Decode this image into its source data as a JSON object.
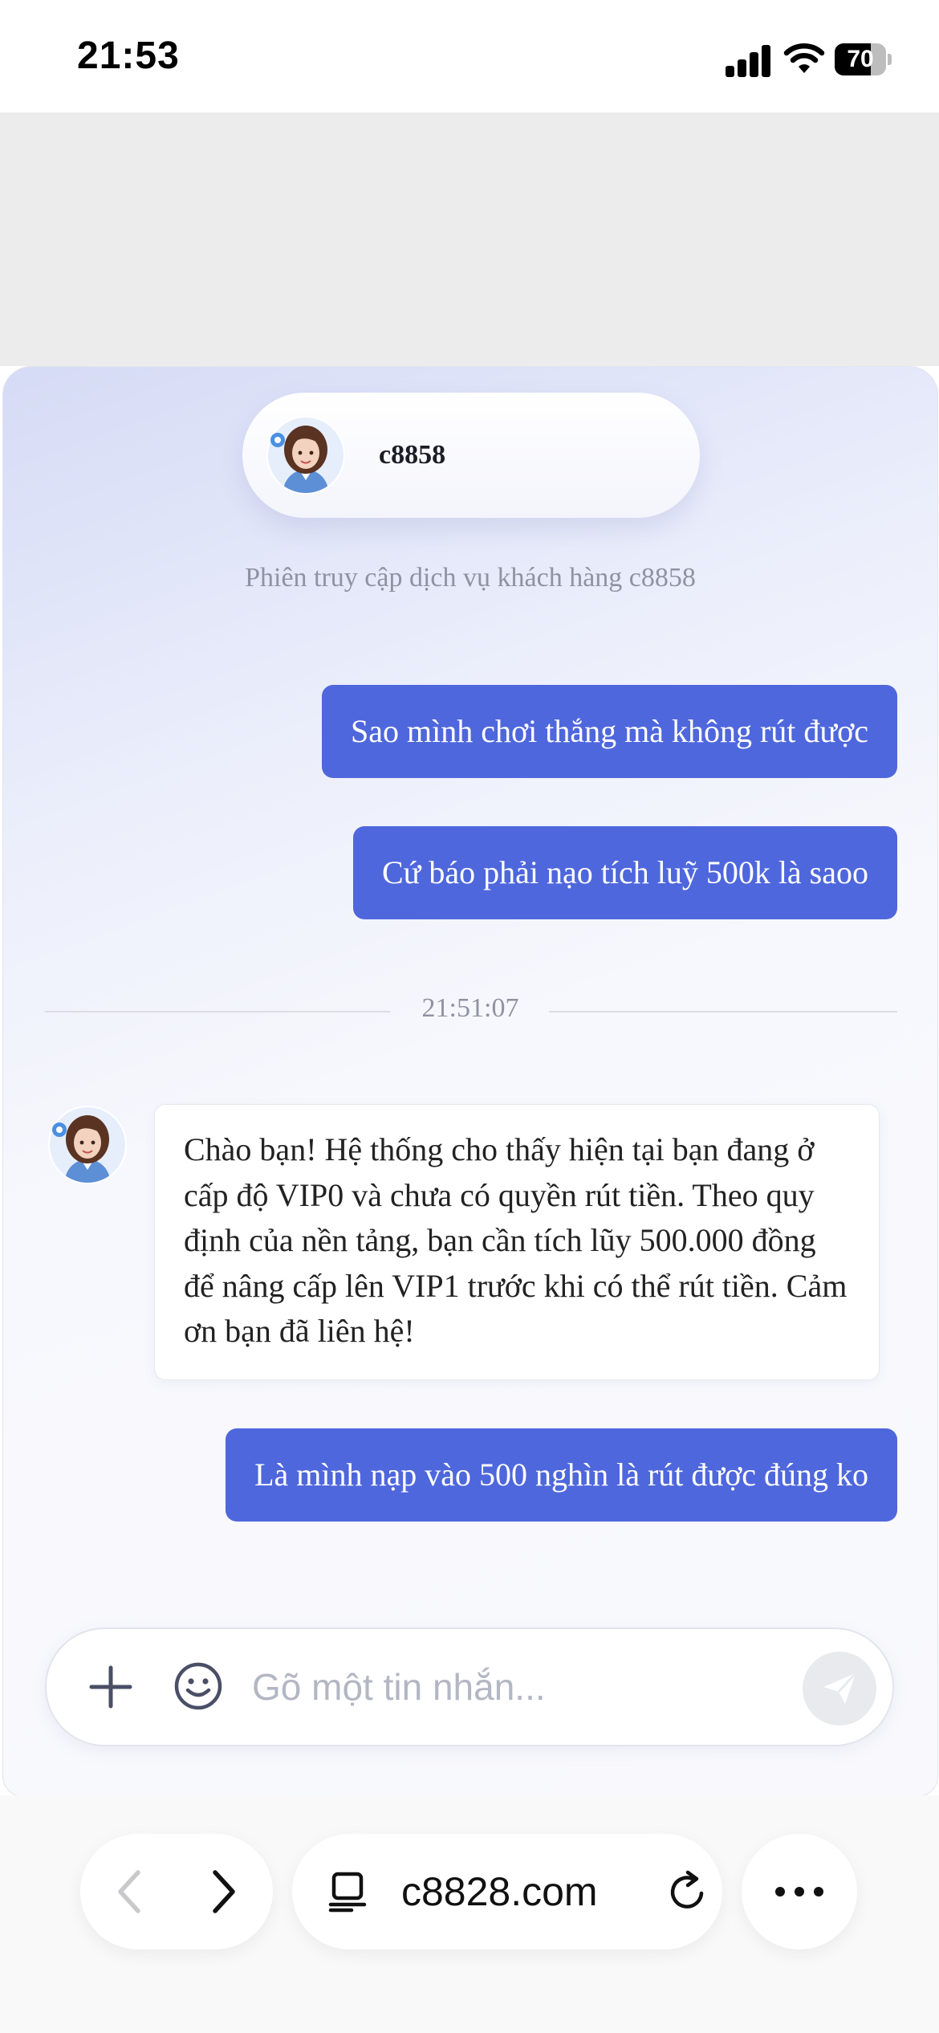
{
  "status_bar": {
    "time": "21:53",
    "battery_level": 70
  },
  "chat": {
    "agent_name": "c8858",
    "session_note": "Phiên truy cập dịch vụ khách hàng c8858",
    "messages": [
      {
        "from": "user",
        "text": "Sao mình chơi thắng mà không rút được"
      },
      {
        "from": "user",
        "text": "Cứ báo phải nạo tích luỹ 500k là saoo"
      },
      {
        "from": "agent",
        "text": "Chào bạn! Hệ thống cho thấy hiện tại bạn đang ở cấp độ VIP0 và chưa có quyền rút tiền. Theo quy định của nền tảng, bạn cần tích lũy 500.000 đồng để nâng cấp lên VIP1 trước khi có thể rút tiền. Cảm ơn bạn đã liên hệ!"
      },
      {
        "from": "user",
        "text": "Là mình nạp vào 500 nghìn là rút được đúng ko"
      }
    ],
    "timestamp": "21:51:07",
    "composer_placeholder": "Gõ một tin nhắn...",
    "composer_value": "",
    "user_bubble_color": "#4f67dc"
  },
  "browser": {
    "url": "c8828.com"
  },
  "icons": {
    "status": [
      "signal-icon",
      "wifi-icon",
      "battery-icon"
    ],
    "composer": [
      "plus-icon",
      "emoji-icon",
      "send-icon"
    ],
    "toolbar": [
      "back-icon",
      "forward-icon",
      "page-icon",
      "reload-icon",
      "more-icon"
    ]
  }
}
